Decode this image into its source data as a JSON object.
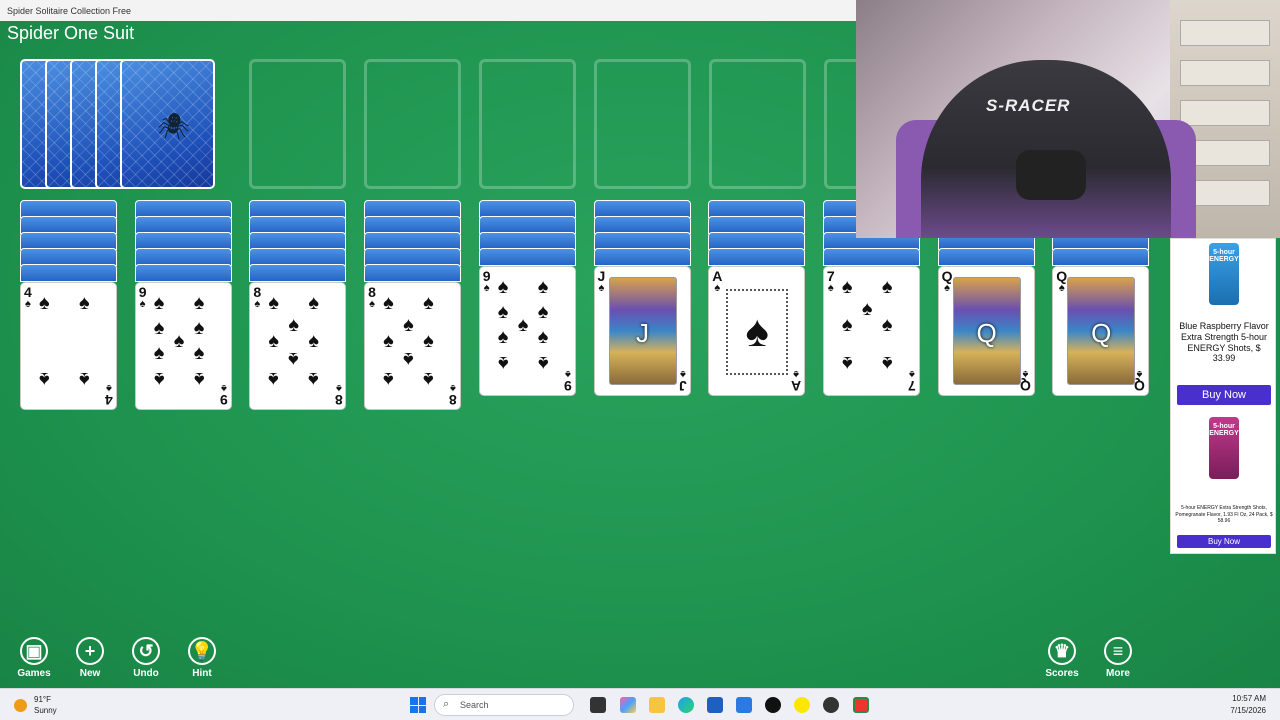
{
  "window": {
    "title": "Spider Solitaire Collection Free"
  },
  "game": {
    "title": "Spider One Suit"
  },
  "stock": {
    "piles": 5
  },
  "foundations": {
    "count": 8
  },
  "tableau": [
    {
      "rank": "4",
      "suit": "♠",
      "style": "pips",
      "pips": 4
    },
    {
      "rank": "9",
      "suit": "♠",
      "style": "pips",
      "pips": 9
    },
    {
      "rank": "8",
      "suit": "♠",
      "style": "pips",
      "pips": 8
    },
    {
      "rank": "8",
      "suit": "♠",
      "style": "pips",
      "pips": 8
    },
    {
      "rank": "9",
      "suit": "♠",
      "style": "pips",
      "pips": 9
    },
    {
      "rank": "J",
      "suit": "♠",
      "style": "court",
      "pips": 0
    },
    {
      "rank": "A",
      "suit": "♠",
      "style": "ace",
      "pips": 1
    },
    {
      "rank": "7",
      "suit": "♠",
      "style": "pips",
      "pips": 7
    },
    {
      "rank": "Q",
      "suit": "♠",
      "style": "court",
      "pips": 0
    },
    {
      "rank": "Q",
      "suit": "♠",
      "style": "court",
      "pips": 0
    }
  ],
  "toolbar": {
    "games": "Games",
    "new": "New",
    "undo": "Undo",
    "hint": "Hint",
    "scores": "Scores",
    "more": "More"
  },
  "webcam": {
    "chair_logo": "S-RACER"
  },
  "ad": {
    "product1": "Blue Raspberry Flavor Extra Strength 5-hour ENERGY Shots, $ 33.99",
    "buy1": "Buy Now",
    "product2": "5-hour ENERGY Extra Strength Shots, Pomegranate Flavor, 1.93 Fl Oz, 24 Pack, $ 58.96",
    "buy2": "Buy Now",
    "can_label": "5-hour ENERGY"
  },
  "taskbar": {
    "weather_temp": "91°F",
    "weather_desc": "Sunny",
    "search_placeholder": "Search",
    "time": "10:57 AM",
    "date": "7/15/2026"
  },
  "colors": {
    "felt": "#1f9550",
    "card_back": "#2463c6",
    "ad_button": "#4a2fcf"
  }
}
